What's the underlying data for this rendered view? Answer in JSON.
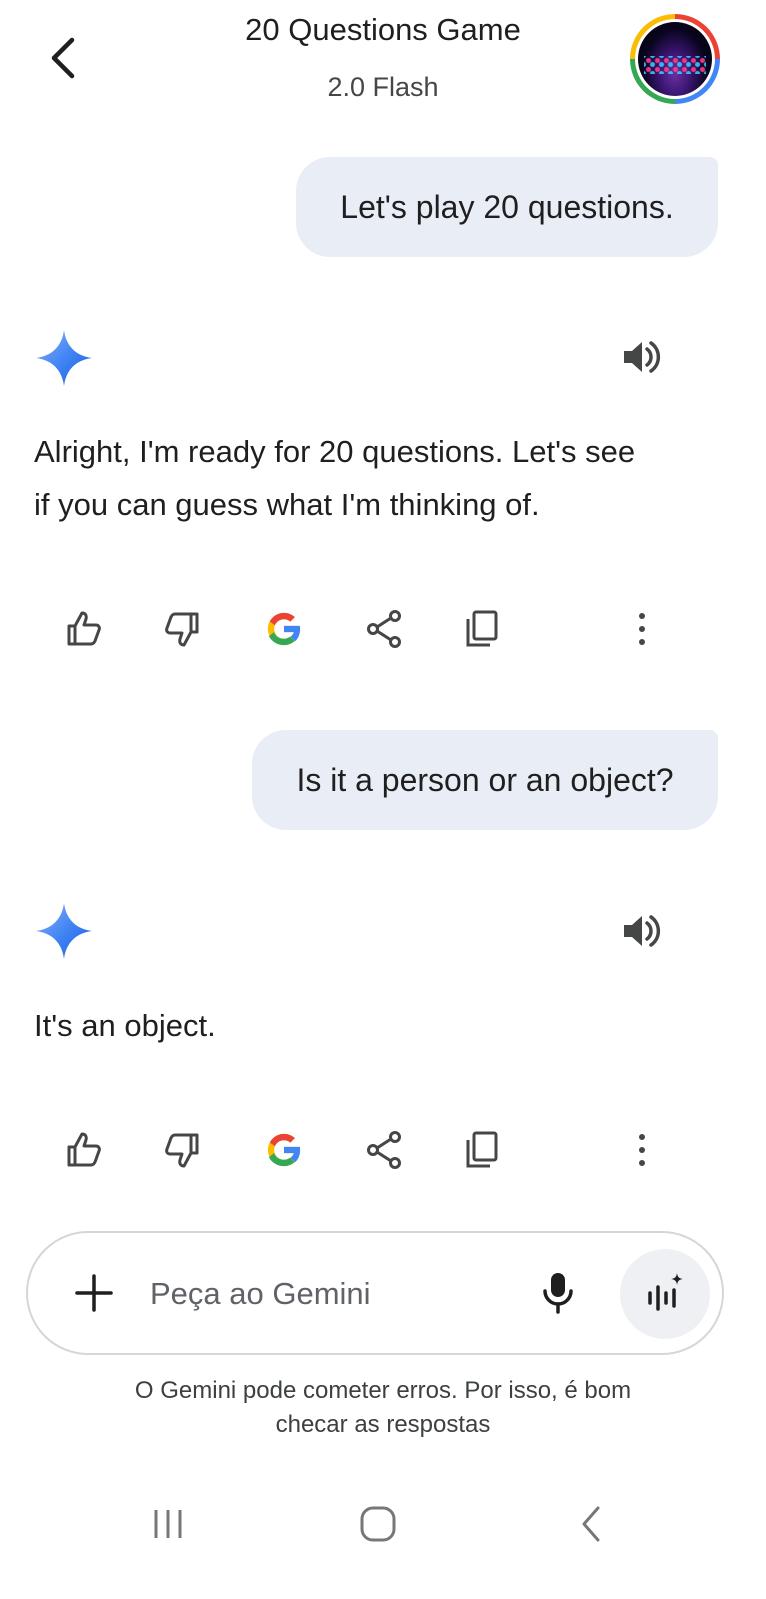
{
  "header": {
    "title": "20 Questions Game",
    "model": "2.0 Flash",
    "back_icon": "back-arrow-icon",
    "avatar_icon": "profile-avatar"
  },
  "conversation": {
    "messages": [
      {
        "role": "user",
        "text": "Let's play 20 questions."
      },
      {
        "role": "model",
        "lines": [
          "Alright, I'm ready for 20 questions. Let's see",
          "if you can guess what I'm thinking of."
        ]
      },
      {
        "role": "user",
        "text": "Is it a person or an object?"
      },
      {
        "role": "model",
        "lines": [
          "It's an object."
        ]
      }
    ],
    "model_icon": "gemini-sparkle-icon",
    "speaker_icon": "speaker-icon",
    "action_icons": [
      "thumbs-up-icon",
      "thumbs-down-icon",
      "google-icon",
      "share-icon",
      "copy-icon",
      "more-vert-icon"
    ]
  },
  "input": {
    "placeholder": "Peça ao Gemini",
    "value": "",
    "add_icon": "plus-icon",
    "mic_icon": "mic-icon",
    "live_icon": "gemini-live-icon"
  },
  "disclaimer": {
    "line1": "O Gemini pode cometer erros. Por isso, é bom",
    "line2": "checar as respostas"
  },
  "nav": {
    "icons": [
      "recents-icon",
      "home-icon",
      "back-icon"
    ]
  },
  "colors": {
    "user_bubble": "#e9eef6",
    "gemini_blue": "#4285f4",
    "google_red": "#ea4335",
    "google_yellow": "#fbbc04",
    "google_green": "#34a853"
  }
}
